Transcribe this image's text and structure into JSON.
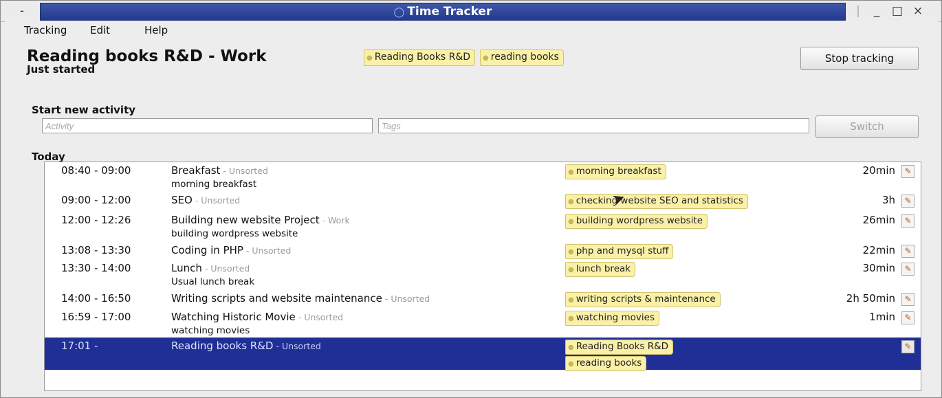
{
  "window": {
    "title": "Time Tracker",
    "menu_button": "-",
    "app_icon": "clock-icon",
    "controls": {
      "minimize": "_",
      "maximize": "□",
      "close": "×"
    }
  },
  "menubar": {
    "items": [
      "Tracking",
      "Edit",
      "Help"
    ]
  },
  "current": {
    "title": "Reading books R&D - Work",
    "status": "Just started",
    "tags": [
      "Reading Books R&D",
      "reading books"
    ],
    "stop_label": "Stop tracking"
  },
  "start_new": {
    "label": "Start new activity",
    "activity_placeholder": "Activity",
    "tags_placeholder": "Tags",
    "switch_label": "Switch"
  },
  "today": {
    "label": "Today",
    "rows": [
      {
        "time": "08:40 - 09:00",
        "name": "Breakfast",
        "category": " - Unsorted",
        "desc": "morning breakfast",
        "tags": [
          "morning breakfast"
        ],
        "duration": "20min"
      },
      {
        "time": "09:00 - 12:00",
        "name": "SEO",
        "category": " - Unsorted",
        "desc": "",
        "tags": [
          "checking website SEO and statistics"
        ],
        "duration": "3h"
      },
      {
        "time": "12:00 - 12:26",
        "name": "Building new website Project",
        "category": " - Work",
        "desc": "building wordpress website",
        "tags": [
          "building wordpress website"
        ],
        "duration": "26min"
      },
      {
        "time": "13:08 - 13:30",
        "name": "Coding in PHP",
        "category": " - Unsorted",
        "desc": "",
        "tags": [
          "php and mysql stuff"
        ],
        "duration": "22min"
      },
      {
        "time": "13:30 - 14:00",
        "name": "Lunch",
        "category": " - Unsorted",
        "desc": "Usual lunch break",
        "tags": [
          "lunch break"
        ],
        "duration": "30min"
      },
      {
        "time": "14:00 - 16:50",
        "name": "Writing scripts and website maintenance",
        "category": " - Unsorted",
        "desc": "",
        "tags": [
          "writing scripts & maintenance"
        ],
        "duration": "2h 50min"
      },
      {
        "time": "16:59 - 17:00",
        "name": "Watching Historic Movie",
        "category": " - Unsorted",
        "desc": "watching movies",
        "tags": [
          "watching movies"
        ],
        "duration": "1min"
      },
      {
        "time": "17:01 -",
        "name": "Reading books R&D",
        "category": " - Unsorted",
        "desc": "",
        "tags": [
          "Reading Books R&D",
          "reading books"
        ],
        "duration": ""
      }
    ]
  },
  "colors": {
    "titlebar": "#23398e",
    "selection": "#1f2f96",
    "tag_bg": "#faf0a8",
    "tag_border": "#d0c470"
  }
}
